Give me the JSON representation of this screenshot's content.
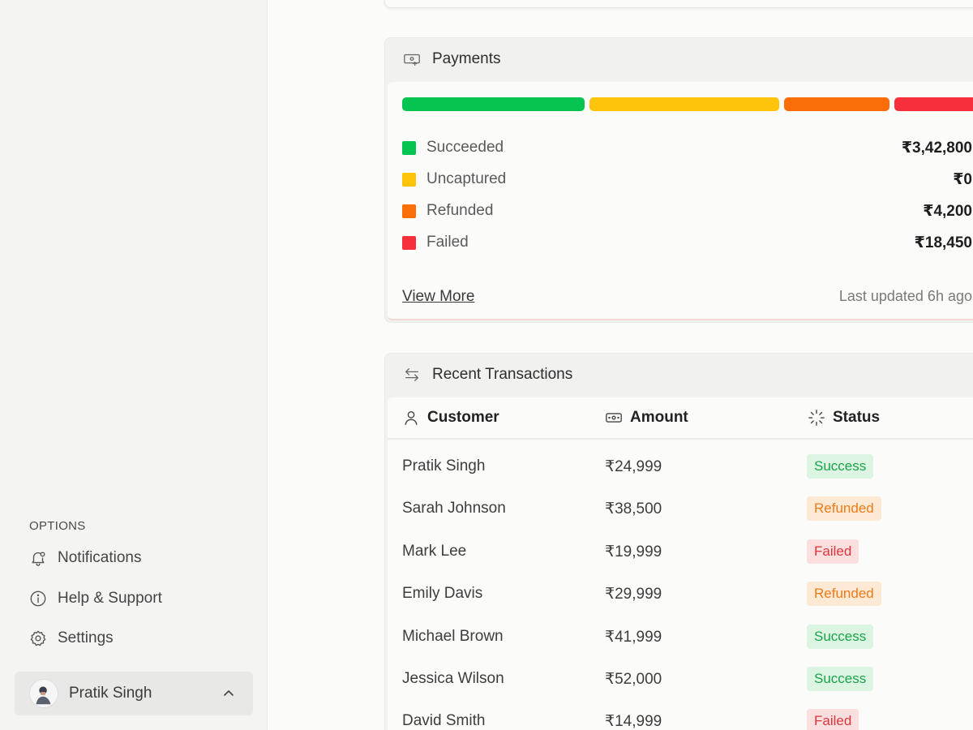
{
  "colors": {
    "succeeded": "#05c44f",
    "uncaptured": "#fec30b",
    "refunded": "#f96e09",
    "failed": "#f72f3b"
  },
  "sidebar": {
    "options_label": "OPTIONS",
    "items": [
      {
        "label": "Notifications",
        "icon": "bell-icon"
      },
      {
        "label": "Help & Support",
        "icon": "info-icon"
      },
      {
        "label": "Settings",
        "icon": "gear-icon"
      }
    ],
    "user": {
      "name": "Pratik Singh",
      "icon": "chevron-up-icon"
    }
  },
  "payments": {
    "title": "Payments",
    "icon": "payment-icon",
    "legend": [
      {
        "label": "Succeeded",
        "value": "₹3,42,800"
      },
      {
        "label": "Uncaptured",
        "value": "₹0"
      },
      {
        "label": "Refunded",
        "value": "₹4,200"
      },
      {
        "label": "Failed",
        "value": "₹18,450"
      }
    ],
    "view_more": "View More",
    "last_updated": "Last updated 6h ago"
  },
  "transactions": {
    "title": "Recent Transactions",
    "icon": "swap-arrows-icon",
    "columns": [
      {
        "label": "Customer",
        "icon": "user-icon"
      },
      {
        "label": "Amount",
        "icon": "cash-icon"
      },
      {
        "label": "Status",
        "icon": "loader-icon"
      }
    ],
    "rows": [
      {
        "customer": "Pratik Singh",
        "amount": "₹24,999",
        "status": "Success"
      },
      {
        "customer": "Sarah Johnson",
        "amount": "₹38,500",
        "status": "Refunded"
      },
      {
        "customer": "Mark Lee",
        "amount": "₹19,999",
        "status": "Failed"
      },
      {
        "customer": "Emily Davis",
        "amount": "₹29,999",
        "status": "Refunded"
      },
      {
        "customer": "Michael Brown",
        "amount": "₹41,999",
        "status": "Success"
      },
      {
        "customer": "Jessica Wilson",
        "amount": "₹52,000",
        "status": "Success"
      },
      {
        "customer": "David Smith",
        "amount": "₹14,999",
        "status": "Failed"
      }
    ]
  }
}
